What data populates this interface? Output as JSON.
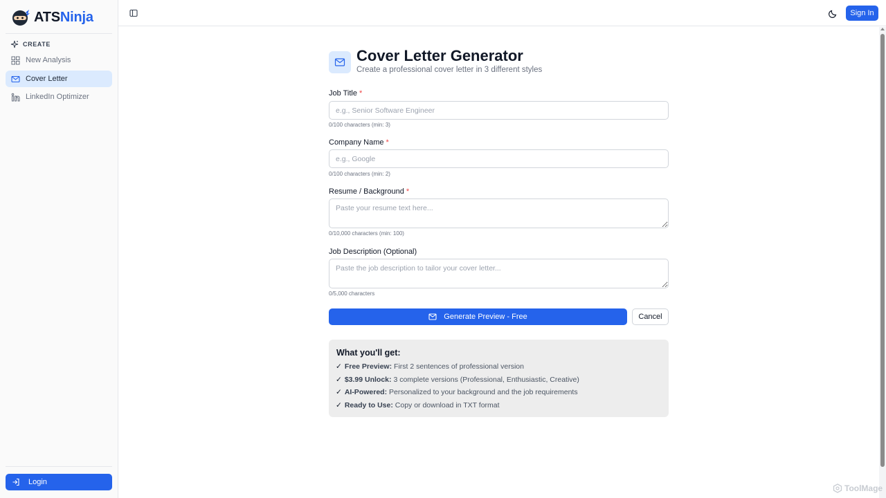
{
  "sidebar": {
    "logo_part1": "ATS",
    "logo_part2": "Ninja",
    "section_label": "CREATE",
    "items": [
      {
        "label": "New Analysis"
      },
      {
        "label": "Cover Letter"
      },
      {
        "label": "LinkedIn Optimizer"
      }
    ],
    "login_label": "Login"
  },
  "header": {
    "signin_label": "Sign In"
  },
  "main": {
    "title": "Cover Letter Generator",
    "subtitle": "Create a professional cover letter in 3 different styles",
    "fields": [
      {
        "label": "Job Title",
        "required": "*",
        "placeholder": "e.g., Senior Software Engineer",
        "value": "",
        "hint": "0/100 characters (min: 3)"
      },
      {
        "label": "Company Name",
        "required": "*",
        "placeholder": "e.g., Google",
        "value": "",
        "hint": "0/100 characters (min: 2)"
      },
      {
        "label": "Resume / Background",
        "required": "*",
        "placeholder": "Paste your resume text here...",
        "value": "",
        "hint": "0/10,000 characters (min: 100)"
      },
      {
        "label": "Job Description (Optional)",
        "placeholder": "Paste the job description to tailor your cover letter...",
        "value": "",
        "hint": "0/5,000 characters"
      }
    ],
    "generate_label": "Generate Preview - Free",
    "cancel_label": "Cancel",
    "info": {
      "title": "What you'll get:",
      "check": "✓",
      "items": [
        {
          "bold": "Free Preview:",
          "text": "First 2 sentences of professional version"
        },
        {
          "bold": "$3.99 Unlock:",
          "text": "3 complete versions (Professional, Enthusiastic, Creative)"
        },
        {
          "bold": "AI-Powered:",
          "text": "Personalized to your background and the job requirements"
        },
        {
          "bold": "Ready to Use:",
          "text": "Copy or download in TXT format"
        }
      ]
    }
  },
  "watermark": "ToolMage",
  "colors": {
    "accent": "#2563eb",
    "active_bg": "#dbeafe",
    "required": "#ef4444"
  }
}
